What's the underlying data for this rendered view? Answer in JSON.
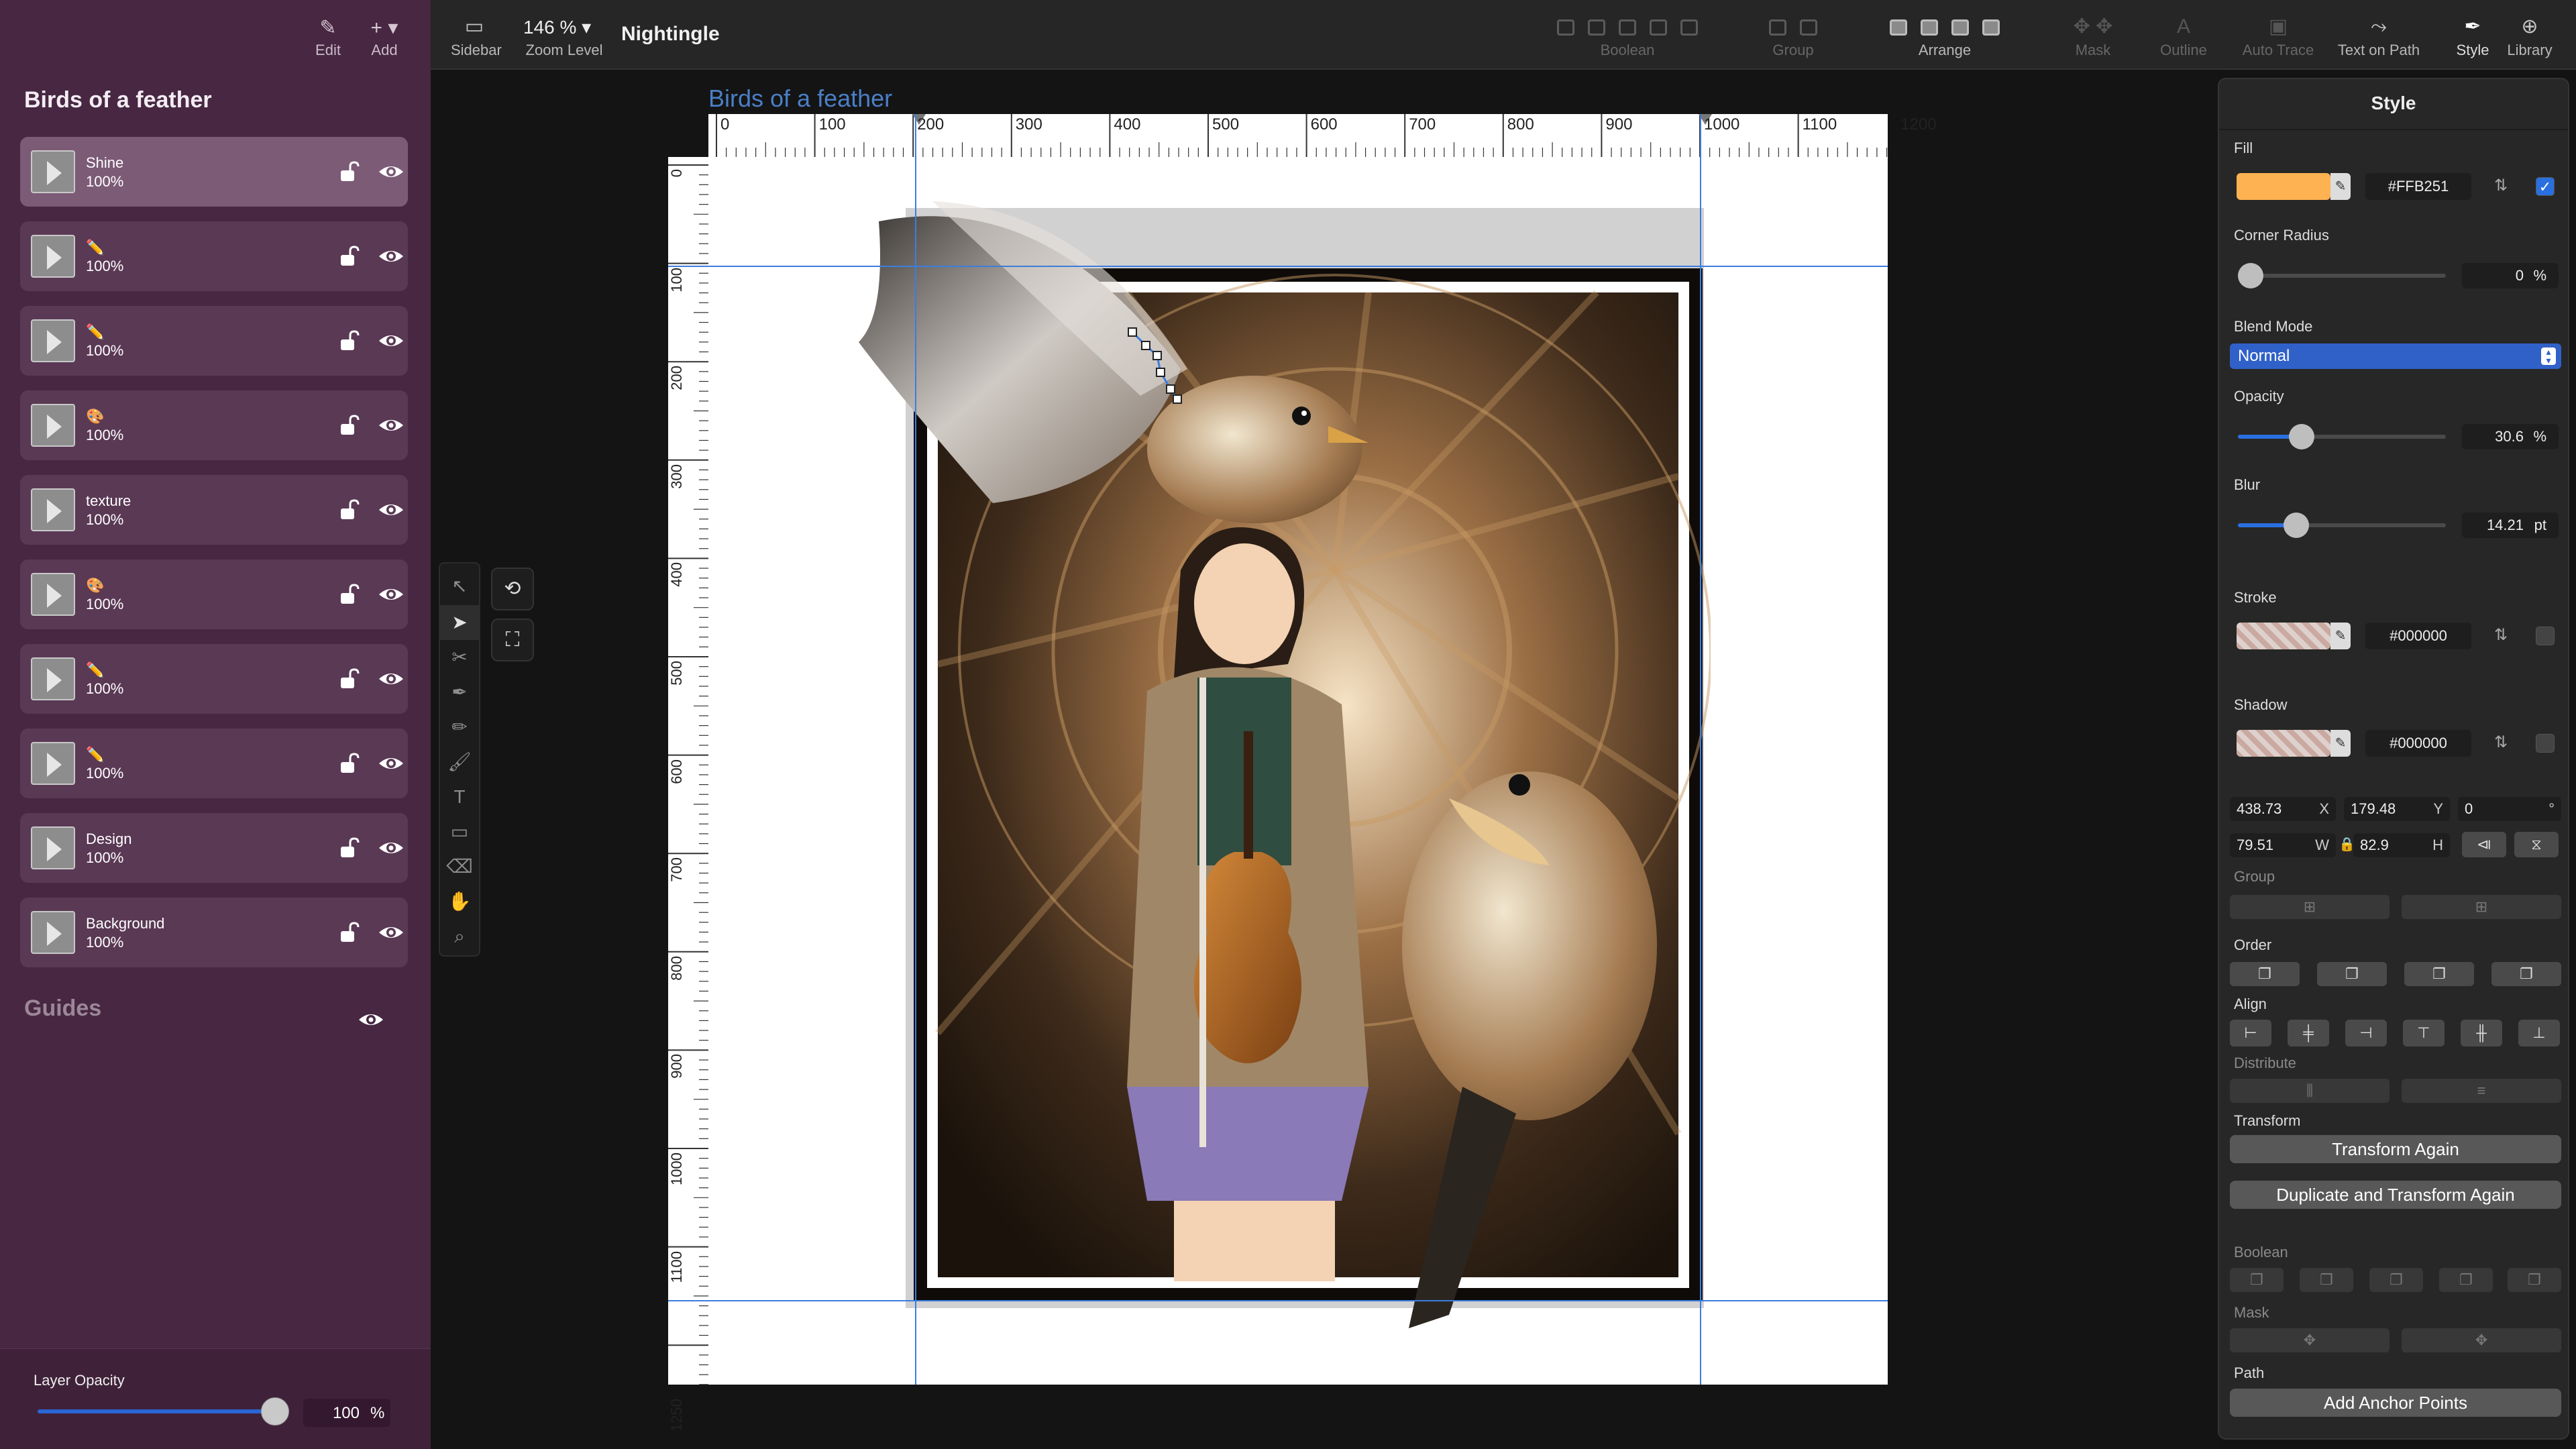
{
  "sidebar": {
    "tools": [
      {
        "icon": "pencil-icon",
        "label": "Edit"
      },
      {
        "icon": "plus-icon",
        "label": "Add"
      }
    ],
    "document_title": "Birds of a feather",
    "layers": [
      {
        "name": "Shine",
        "opacity": "100%",
        "selected": true
      },
      {
        "name": "",
        "badge": "✏️",
        "opacity": "100%"
      },
      {
        "name": "",
        "badge": "✏️",
        "opacity": "100%"
      },
      {
        "name": "",
        "badge": "🎨",
        "opacity": "100%"
      },
      {
        "name": "texture",
        "opacity": "100%"
      },
      {
        "name": "",
        "badge": "🎨",
        "opacity": "100%"
      },
      {
        "name": "",
        "badge": "✏️",
        "opacity": "100%"
      },
      {
        "name": "",
        "badge": "✏️",
        "opacity": "100%"
      },
      {
        "name": "Design",
        "opacity": "100%"
      },
      {
        "name": "Background",
        "opacity": "100%"
      }
    ],
    "guides_label": "Guides",
    "layer_opacity": {
      "label": "Layer Opacity",
      "value": "100",
      "unit": "%",
      "fraction": 1.0
    }
  },
  "toolbar": {
    "sidebar_label": "Sidebar",
    "zoom_value": "146 %",
    "zoom_label": "Zoom Level",
    "app_name": "Nightingle",
    "groups": {
      "boolean": "Boolean",
      "group": "Group",
      "arrange": "Arrange",
      "mask": "Mask",
      "outline": "Outline",
      "auto_trace": "Auto Trace",
      "text_on_path": "Text on Path",
      "style": "Style",
      "library": "Library"
    }
  },
  "canvas": {
    "page_label": "Birds of a feather",
    "ruler_h": [
      "0",
      "100",
      "200",
      "300",
      "400",
      "500",
      "600",
      "700",
      "800",
      "900",
      "1000",
      "1100",
      "1200"
    ],
    "ruler_v": [
      "0",
      "100",
      "200",
      "300",
      "400",
      "500",
      "600",
      "700",
      "800",
      "900",
      "1000",
      "1100",
      "1250"
    ]
  },
  "style_panel": {
    "title": "Style",
    "fill": {
      "label": "Fill",
      "color": "#FFB251",
      "hex": "#FFB251",
      "enabled": true
    },
    "corner_radius": {
      "label": "Corner Radius",
      "value": "0",
      "unit": "%",
      "fraction": 0.0
    },
    "blend_mode": {
      "label": "Blend Mode",
      "value": "Normal"
    },
    "opacity": {
      "label": "Opacity",
      "value": "30.6",
      "unit": "%",
      "fraction": 0.306
    },
    "blur": {
      "label": "Blur",
      "value": "14.21",
      "unit": "pt",
      "fraction": 0.28
    },
    "stroke": {
      "label": "Stroke",
      "hex": "#000000",
      "enabled": false
    },
    "shadow": {
      "label": "Shadow",
      "hex": "#000000",
      "enabled": false
    },
    "geometry": {
      "x": "438.73",
      "x_label": "X",
      "y": "179.48",
      "y_label": "Y",
      "rotation": "0",
      "rotation_unit": "°",
      "w": "79.51",
      "w_label": "W",
      "h": "82.9",
      "h_label": "H"
    },
    "group_label": "Group",
    "order_label": "Order",
    "align_label": "Align",
    "distribute_label": "Distribute",
    "transform_label": "Transform",
    "transform_again": "Transform Again",
    "duplicate_transform_again": "Duplicate and Transform Again",
    "boolean_label": "Boolean",
    "mask_label": "Mask",
    "path_label": "Path",
    "add_anchor_points": "Add Anchor Points"
  }
}
